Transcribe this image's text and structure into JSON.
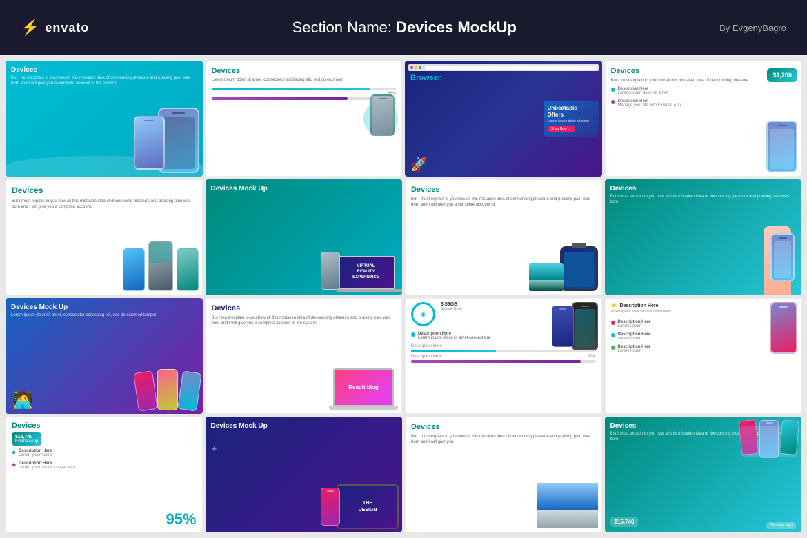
{
  "header": {
    "logo_icon": "⚡",
    "logo_text": "envato",
    "title_prefix": "Section Name: ",
    "title_bold": "Devices MockUp",
    "by_text": "By EvgenyBagro"
  },
  "grid": {
    "cells": [
      {
        "id": "r1c1",
        "row": 1,
        "col": 1,
        "title": "Devices",
        "theme": "teal-bg",
        "desc": "But I must explain to you how all this mistaken idea of denouncing pleasure and praising pain was born and I will give you a complete account of the system."
      },
      {
        "id": "r1c2",
        "row": 1,
        "col": 2,
        "title": "Devices",
        "theme": "white-bg",
        "desc": "Lorem ipsum dolor sit amet, consectetur adipiscing elit, sed do eiusmod.",
        "progress1": 86,
        "progress2": 74
      },
      {
        "id": "r1c3",
        "row": 1,
        "col": 3,
        "title": "Browser",
        "theme": "dark-bg",
        "offer_title": "Unbeatable Offers",
        "offer_sub": "Lorem ipsum dolor sit amet"
      },
      {
        "id": "r1c4",
        "row": 1,
        "col": 4,
        "title": "Devices",
        "theme": "white-bg",
        "desc": "But I must explain to you how all this mistaken idea of denouncing pleasure.",
        "price": "$1,200",
        "desc2": "Manage your life with Finance App"
      },
      {
        "id": "r2c1",
        "row": 2,
        "col": 1,
        "title": "Devices",
        "theme": "white-bg",
        "desc": "But I must explain to you how all this mistaken idea of denouncing pleasure and praising pain was born and I will give you a complete account."
      },
      {
        "id": "r2c2",
        "row": 2,
        "col": 2,
        "title": "Devices Mock Up",
        "theme": "teal-bg",
        "vr_text": "VIRTUAL\nREALITY\nEXPERIENCE"
      },
      {
        "id": "r2c3",
        "row": 2,
        "col": 3,
        "title": "Devices",
        "theme": "white-bg",
        "desc": "But I must explain to you how all this mistaken idea of denouncing pleasure and praising pain was born and I will give you a complete account of."
      },
      {
        "id": "r2c4",
        "row": 2,
        "col": 4,
        "title": "Devices",
        "theme": "teal-bg",
        "desc": "But I must explain to you how all this mistaken idea of denouncing pleasure and praising pain was born."
      },
      {
        "id": "r3c1",
        "row": 3,
        "col": 1,
        "title": "Devices Mock Up",
        "theme": "blue-purple-bg",
        "desc": "Lorem ipsum dolor sit amet, consectetur adipiscing elit, sed do eiusmod tempor."
      },
      {
        "id": "r3c2",
        "row": 3,
        "col": 2,
        "title": "Devices",
        "theme": "white-bg",
        "desc": "But I must explain to you how all this mistaken idea of denouncing pleasure and praising pain was born and I will give you a complete account of the system.",
        "blog_name": "Readit blog"
      },
      {
        "id": "r3c3",
        "row": 3,
        "col": 3,
        "title": "Description Here",
        "theme": "white-bg",
        "storage": "3.59GB",
        "desc": "Description Here",
        "progress1": 46,
        "progress2": 92
      },
      {
        "id": "r3c4",
        "row": 3,
        "col": 4,
        "title": "Description Here",
        "theme": "white-bg",
        "desc1": "Description Here",
        "desc2": "Description Here",
        "desc3": "Description Here"
      },
      {
        "id": "r4c1",
        "row": 4,
        "col": 1,
        "title": "Devices",
        "theme": "white-bg",
        "price2": "$15,740",
        "app_name": "Finance App",
        "percent": "95%"
      },
      {
        "id": "r4c2",
        "row": 4,
        "col": 2,
        "title": "Devices Mock Up",
        "theme": "blue-purple-bg",
        "design_text": "THE\nDESIGN"
      },
      {
        "id": "r4c3",
        "row": 4,
        "col": 3,
        "title": "Devices",
        "theme": "white-bg",
        "desc": "But I must explain to you how all this mistaken idea of denouncing pleasure and praising pain was born and I will give you."
      },
      {
        "id": "r4c4",
        "row": 4,
        "col": 4,
        "title": "Devices",
        "theme": "teal-bg",
        "desc": "But I must explain to you how all this mistaken idea of denouncing pleasure and praising pain was born.",
        "price3": "$15,740"
      }
    ]
  }
}
